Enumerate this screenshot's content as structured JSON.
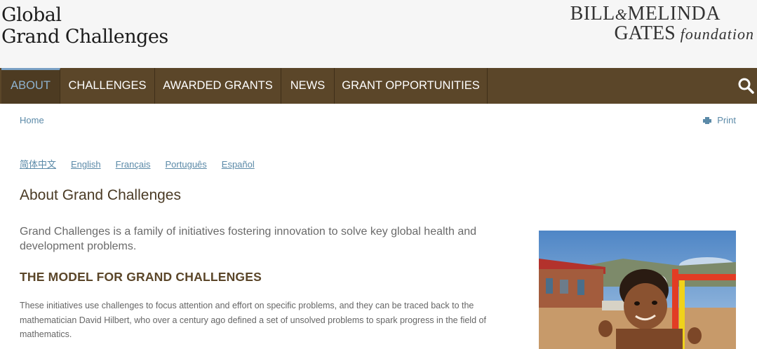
{
  "header": {
    "site_logo": {
      "line1": "Global",
      "line2": "Grand Challenges"
    },
    "foundation_logo": {
      "bill": "BILL",
      "amp": "&",
      "melinda": "MELINDA",
      "gates": "GATES",
      "foundation": "foundation"
    }
  },
  "nav": {
    "items": [
      {
        "label": "ABOUT",
        "active": true
      },
      {
        "label": "CHALLENGES",
        "active": false
      },
      {
        "label": "AWARDED GRANTS",
        "active": false
      },
      {
        "label": "NEWS",
        "active": false
      },
      {
        "label": "GRANT OPPORTUNITIES",
        "active": false
      }
    ],
    "search_icon": "search-icon"
  },
  "breadcrumb": {
    "home": "Home"
  },
  "print": {
    "label": "Print",
    "icon": "printer-icon"
  },
  "languages": [
    "简体中文",
    "English",
    "Français",
    "Português",
    "Español"
  ],
  "main": {
    "title": "About Grand Challenges",
    "lead": "Grand Challenges is a family of initiatives fostering innovation to solve key global health and development problems.",
    "section_title": "THE MODEL FOR GRAND CHALLENGES",
    "body": "These initiatives use challenges to focus attention and effort on specific problems, and they can be traced back to the mathematician David Hilbert, who over a century ago defined a set of unsolved problems to spark progress in the field of mathematics."
  },
  "colors": {
    "nav_bg": "#5b4629",
    "nav_active_text": "#8fb3d0",
    "link": "#5b8aa8",
    "heading": "#5b4629"
  }
}
